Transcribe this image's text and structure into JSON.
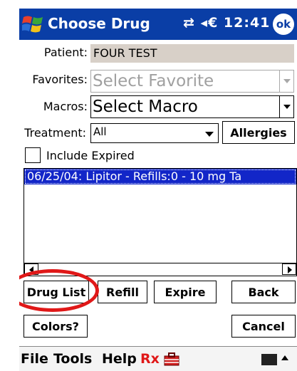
{
  "titlebar": {
    "title": "Choose Drug",
    "tray": "⇄ ◂€ 12:41",
    "ok_label": "ok"
  },
  "form": {
    "patient_label": "Patient:",
    "patient_value": "FOUR TEST",
    "favorites_label": "Favorites:",
    "favorites_placeholder": "Select Favorite",
    "macros_label": "Macros:",
    "macros_value": "Select Macro",
    "treatment_label": "Treatment:",
    "treatment_value": "All",
    "allergies_label": "Allergies",
    "include_expired_label": "Include Expired",
    "include_expired_checked": false
  },
  "drug_list": {
    "rows": [
      "06/25/04: Lipitor - Refills:0 - 10 mg Ta"
    ],
    "selected_color": "#1226c8"
  },
  "buttons": {
    "drug_list": "Drug List",
    "refill": "Refill",
    "expire": "Expire",
    "back": "Back",
    "colors": "Colors?",
    "cancel": "Cancel"
  },
  "menubar": {
    "file": "File",
    "tools": "Tools",
    "help": "Help",
    "rx": "Rx"
  },
  "colors": {
    "titlebar_bg": "#0a3ea6",
    "annotation": "#e01818",
    "patient_field_bg": "#d8d0c8"
  }
}
